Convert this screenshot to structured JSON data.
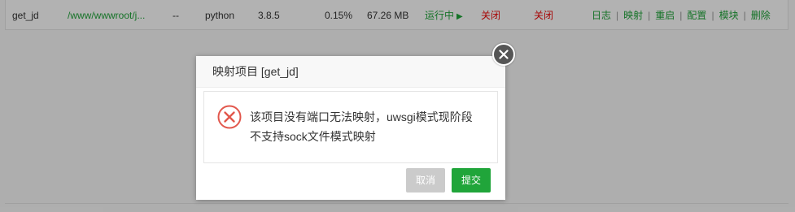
{
  "table": {
    "row": {
      "name": "get_jd",
      "path": "/www/wwwroot/j...",
      "dash": "--",
      "type": "python",
      "version": "3.8.5",
      "cpu": "0.15%",
      "memory": "67.26 MB",
      "status": "运行中",
      "status_icon": "▶",
      "field_a": "关闭",
      "field_b": "关闭",
      "ops": {
        "log": "日志",
        "map": "映射",
        "restart": "重启",
        "config": "配置",
        "module": "模块",
        "delete": "删除",
        "sep": "|"
      }
    }
  },
  "dialog": {
    "title": "映射项目 [get_jd]",
    "message_line1": "该项目没有端口无法映射，uwsgi模式现阶段",
    "message_line2": "不支持sock文件模式映射",
    "cancel_label": "取消",
    "submit_label": "提交",
    "icon": "error-circle-icon"
  },
  "colors": {
    "accent_green": "#20a53a",
    "danger_red": "#ef0808",
    "error_icon": "#e2574c",
    "cancel_gray": "#cbcbcb"
  }
}
